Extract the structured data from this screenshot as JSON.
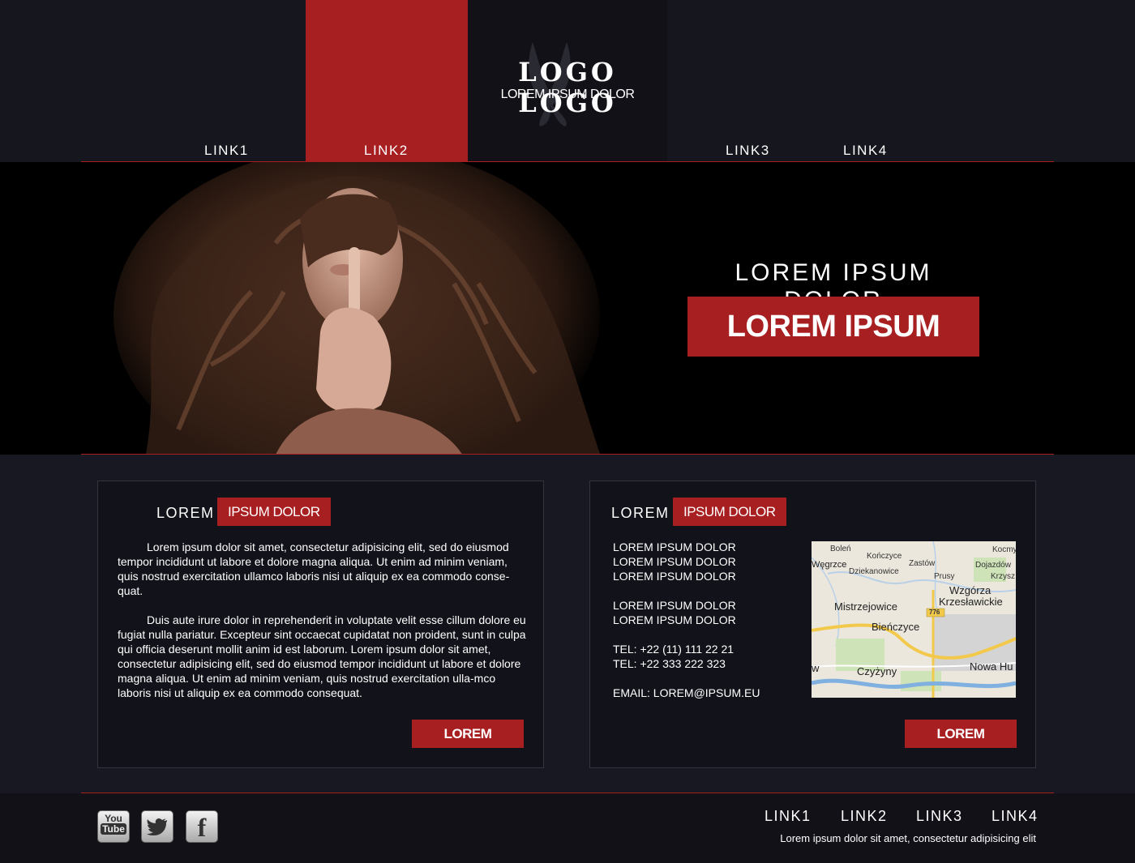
{
  "header": {
    "logo_title": "LOGO LOGO",
    "logo_subtitle": "LOREM IPSUM DOLOR",
    "nav": [
      {
        "label": "LINK1",
        "active": false
      },
      {
        "label": "LINK2",
        "active": true
      },
      {
        "label": "LINK3",
        "active": false
      },
      {
        "label": "LINK4",
        "active": false
      }
    ]
  },
  "hero": {
    "heading": "LOREM IPSUM DOLOR",
    "cta_label": "LOREM IPSUM"
  },
  "panels": {
    "left": {
      "title_plain": "LOREM",
      "title_badge": "IPSUM DOLOR",
      "paragraphs": [
        "Lorem ipsum dolor sit amet, consectetur adipisicing elit, sed do eiusmod tempor incididunt ut labore et dolore magna aliqua. Ut enim ad minim veniam, quis nostrud exercitation ullamco laboris nisi ut aliquip ex ea commodo conse-quat.",
        "Duis aute irure dolor in reprehenderit in voluptate velit esse cillum dolore eu fugiat nulla pariatur. Excepteur sint occaecat cupidatat non proident, sunt in culpa qui officia deserunt mollit anim id est laborum. Lorem ipsum dolor sit amet, consectetur adipisicing elit, sed do eiusmod tempor incididunt ut labore et dolore magna aliqua. Ut enim ad minim veniam, quis nostrud exercitation ulla-mco laboris nisi ut aliquip ex ea commodo consequat."
      ],
      "button_label": "LOREM"
    },
    "right": {
      "title_plain": "LOREM",
      "title_badge": "IPSUM DOLOR",
      "contact_lines": [
        "LOREM IPSUM DOLOR",
        "LOREM IPSUM DOLOR",
        "LOREM IPSUM DOLOR",
        "",
        "LOREM IPSUM DOLOR",
        "LOREM IPSUM DOLOR",
        "",
        "TEL: +22 (11) 111 22 21",
        "TEL: +22 333 222 323",
        "",
        "EMAIL: LOREM@IPSUM.EU"
      ],
      "map_labels": [
        "Boleń",
        "Kończyce",
        "Kocmy",
        "Węgrzce",
        "Zastów",
        "Dojazdów",
        "Dziekanowice",
        "Prusy",
        "Krzysz",
        "Wzgórza",
        "Krzesławickie",
        "Mistrzejowice",
        "776",
        "Bieńczyce",
        "Czyżyny",
        "Nowa Hu",
        "w"
      ],
      "button_label": "LOREM"
    }
  },
  "footer": {
    "social": [
      {
        "name": "youtube",
        "label": "You Tube"
      },
      {
        "name": "twitter",
        "label": "twitter-bird"
      },
      {
        "name": "facebook",
        "label": "f"
      }
    ],
    "links": [
      "LINK1",
      "LINK2",
      "LINK3",
      "LINK4"
    ],
    "note": "Lorem ipsum dolor sit amet, consectetur adipisicing elit"
  },
  "colors": {
    "accent": "#a81f21",
    "background": "#171821",
    "header_bg": "#16161e",
    "hero_bg": "#000000"
  }
}
